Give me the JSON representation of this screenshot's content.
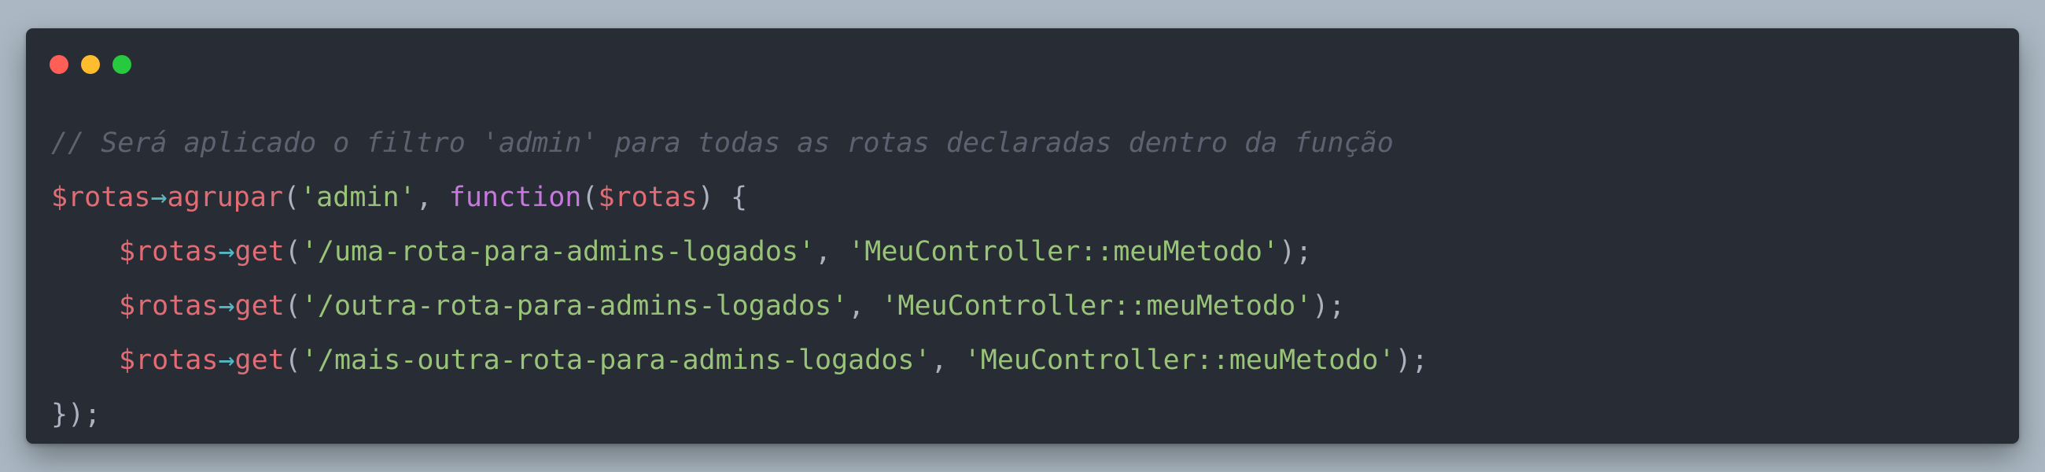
{
  "window": {
    "dots": [
      "close",
      "minimize",
      "maximize"
    ],
    "colors": {
      "background": "#282c34",
      "close": "#ff5f56",
      "minimize": "#ffbd2e",
      "maximize": "#27c93f"
    }
  },
  "code": {
    "comment": "// Será aplicado o filtro 'admin' para todas as rotas declaradas dentro da função",
    "line2": {
      "var": "$rotas",
      "arrow": "→",
      "method": "agrupar",
      "open": "(",
      "arg1": "'admin'",
      "sep": ", ",
      "keyword": "function",
      "paren_open": "(",
      "param": "$rotas",
      "close": ") {"
    },
    "routes": [
      {
        "var": "$rotas",
        "arrow": "→",
        "method": "get",
        "open": "(",
        "path": "'/uma-rota-para-admins-logados'",
        "sep": ", ",
        "handler": "'MeuController::meuMetodo'",
        "close": ");"
      },
      {
        "var": "$rotas",
        "arrow": "→",
        "method": "get",
        "open": "(",
        "path": "'/outra-rota-para-admins-logados'",
        "sep": ", ",
        "handler": "'MeuController::meuMetodo'",
        "close": ");"
      },
      {
        "var": "$rotas",
        "arrow": "→",
        "method": "get",
        "open": "(",
        "path": "'/mais-outra-rota-para-admins-logados'",
        "sep": ", ",
        "handler": "'MeuController::meuMetodo'",
        "close": ");"
      }
    ],
    "closing": "});"
  }
}
